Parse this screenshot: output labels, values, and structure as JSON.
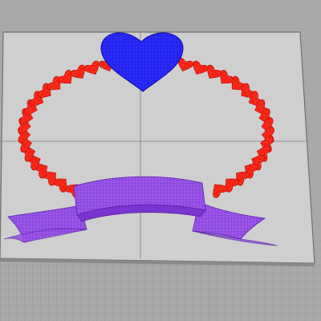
{
  "viewport": {
    "type": "perspective-3d-viewport",
    "colors": {
      "background": "#a9a9a9",
      "plate": "#cfcfcf",
      "plate_edge": "#6e6e6e",
      "grid_line": "#8c8c8c",
      "hearts_ring": "#ff2a1a",
      "top_heart": "#2a2aff",
      "ribbon": "#9a55e8"
    },
    "objects": [
      {
        "name": "heart-ring",
        "kind": "mesh",
        "color": "red"
      },
      {
        "name": "top-heart",
        "kind": "mesh",
        "color": "blue"
      },
      {
        "name": "banner-ribbon",
        "kind": "mesh",
        "color": "purple"
      }
    ]
  }
}
